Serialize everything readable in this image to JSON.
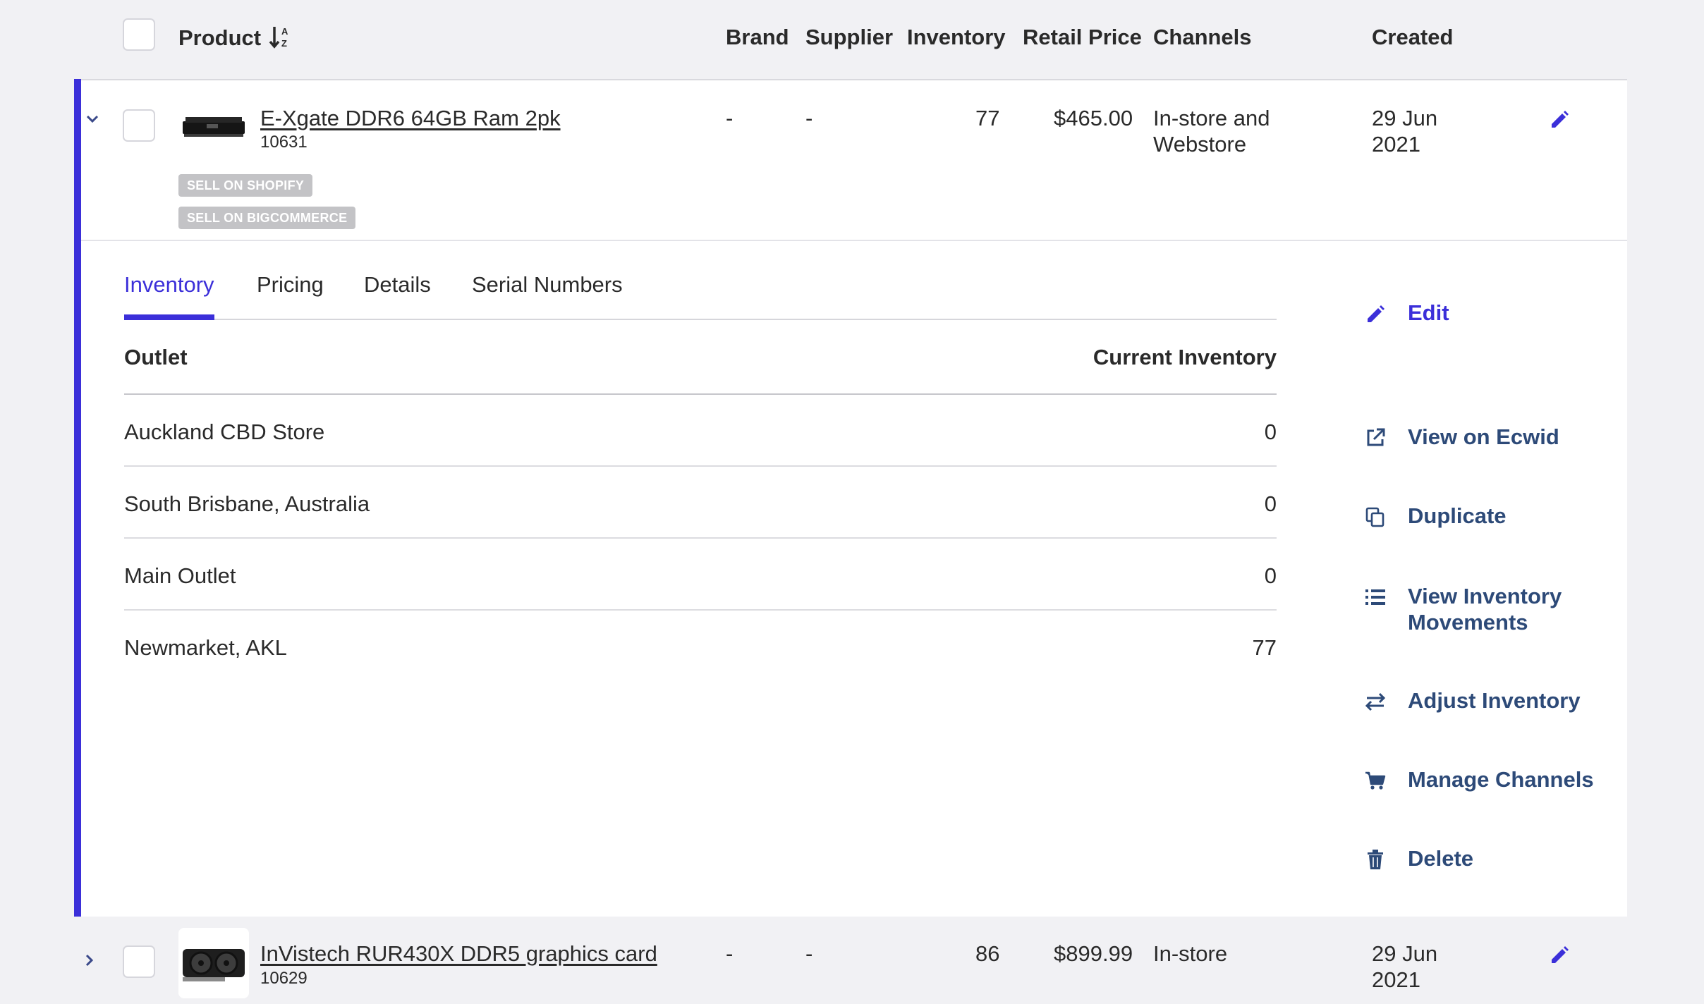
{
  "header": {
    "product": "Product",
    "sort_icon": "sort-alpha-down-icon",
    "brand": "Brand",
    "supplier": "Supplier",
    "inventory": "Inventory",
    "retail_price": "Retail Price",
    "channels": "Channels",
    "created": "Created"
  },
  "rows": [
    {
      "name": "E-Xgate DDR6 64GB Ram 2pk",
      "sku": "10631",
      "brand": "-",
      "supplier": "-",
      "inventory": "77",
      "price": "$465.00",
      "channels_line1": "In-store and",
      "channels_line2": "Webstore",
      "created_line1": "29 Jun",
      "created_line2": "2021",
      "tags": [
        "SELL ON SHOPIFY",
        "SELL ON BIGCOMMERCE"
      ]
    },
    {
      "name": "InVistech RUR430X DDR5 graphics card",
      "sku": "10629",
      "brand": "-",
      "supplier": "-",
      "inventory": "86",
      "price": "$899.99",
      "channels_line1": "In-store",
      "created_line1": "29 Jun",
      "created_line2": "2021"
    }
  ],
  "detail": {
    "tabs": [
      "Inventory",
      "Pricing",
      "Details",
      "Serial Numbers"
    ],
    "active_tab": "Inventory",
    "table": {
      "col_outlet": "Outlet",
      "col_current": "Current Inventory",
      "rows": [
        {
          "outlet": "Auckland CBD Store",
          "qty": "0"
        },
        {
          "outlet": "South Brisbane, Australia",
          "qty": "0"
        },
        {
          "outlet": "Main Outlet",
          "qty": "0"
        },
        {
          "outlet": "Newmarket, AKL",
          "qty": "77"
        }
      ]
    },
    "actions": [
      {
        "label": "Edit",
        "icon": "pencil-icon"
      },
      {
        "label": "View on Ecwid",
        "icon": "external-link-icon"
      },
      {
        "label": "Duplicate",
        "icon": "duplicate-icon"
      },
      {
        "label_line1": "View Inventory",
        "label_line2": "Movements",
        "icon": "list-icon"
      },
      {
        "label": "Adjust Inventory",
        "icon": "arrows-exchange-icon"
      },
      {
        "label": "Manage Channels",
        "icon": "cart-icon"
      },
      {
        "label": "Delete",
        "icon": "trash-icon"
      }
    ]
  },
  "colors": {
    "accent": "#3b2fd9",
    "action_text": "#2d4a78",
    "background": "#f1f1f4",
    "tag_bg": "#c3c3c6"
  }
}
